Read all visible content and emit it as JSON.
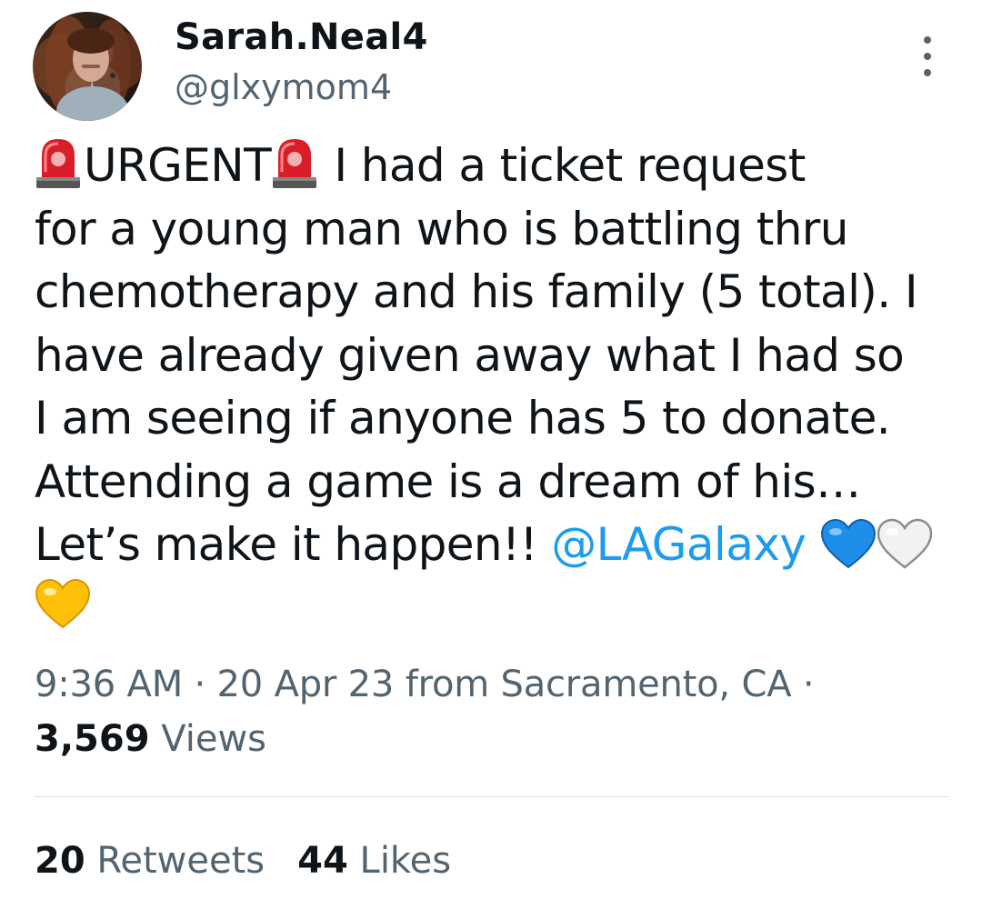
{
  "author": {
    "display_name": "Sarah.Neal4",
    "handle": "@glxymom4"
  },
  "icons": {
    "avatar": "profile-photo",
    "more": "more-vertical-icon",
    "siren": "police-car-light-emoji",
    "blue_heart": "blue-heart-emoji",
    "white_heart": "white-heart-emoji",
    "yellow_heart": "yellow-heart-emoji"
  },
  "tweet": {
    "line1_word": "URGENT",
    "line1_rest": " I had a ticket request",
    "line2": "for a young man who is battling thru",
    "line3": "chemotherapy and his family (5 total). I",
    "line4": "have already given away what I had so",
    "line5": "I am seeing if anyone has 5 to donate.",
    "line6": "Attending a game is a dream of his…",
    "line7_text": "Let’s make it happen!! ",
    "mention": "@LAGalaxy"
  },
  "meta": {
    "timestamp": "9:36 AM · 20 Apr 23 from Sacramento, CA ·",
    "views_count": "3,569",
    "views_label": " Views"
  },
  "stats": {
    "retweets_count": "20",
    "retweets_label": " Retweets",
    "likes_count": "44",
    "likes_label": " Likes"
  },
  "colors": {
    "text": "#0f1419",
    "secondary": "#536471",
    "link": "#1d9bf0",
    "divider": "#dfe3e6"
  }
}
